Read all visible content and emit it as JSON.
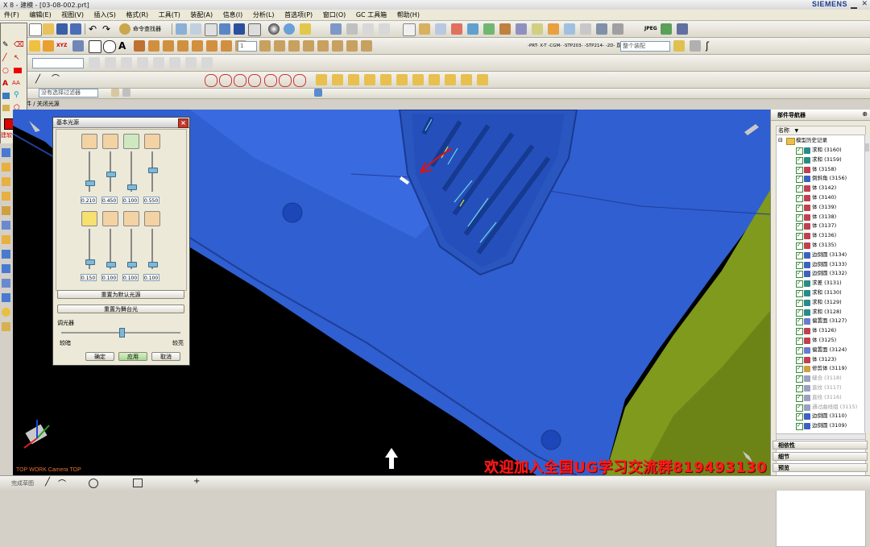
{
  "window": {
    "title": "X 8 - 建模 - [03-08-002.prt]",
    "brand": "SIEMENS"
  },
  "menu": [
    "件(F)",
    "编辑(E)",
    "视图(V)",
    "插入(S)",
    "格式(R)",
    "工具(T)",
    "装配(A)",
    "信息(I)",
    "分析(L)",
    "首选项(P)",
    "窗口(O)",
    "GC 工具箱",
    "帮助(H)"
  ],
  "toolbar": {
    "command_finder": "命令查找器",
    "jpeg": "JPEG",
    "export_text": "-PRT- X-T -CGM- -STP203- -STP214- -2D-  直线和圆弧(A)",
    "no_selection_filter": "没有选择过滤器",
    "layer_value": "1",
    "entire_assembly": "整个装配",
    "breadcrumb": "件 / 关闭光源"
  },
  "palette": {
    "label": "建软件"
  },
  "dialog": {
    "title": "基本光源",
    "row1_values": [
      "0.210",
      "0.450",
      "0.100",
      "0.550"
    ],
    "row1_levels": [
      0.21,
      0.45,
      0.1,
      0.55
    ],
    "row2_values": [
      "0.150",
      "0.100",
      "0.100",
      "0.100"
    ],
    "row2_levels": [
      0.15,
      0.1,
      0.1,
      0.1
    ],
    "reset_default": "重置为默认光源",
    "reset_stage": "重置为舞台光",
    "dimmer_label": "调光器",
    "dimmer_level": 0.5,
    "dark_label": "较暗",
    "bright_label": "较亮",
    "ok": "确定",
    "apply": "应用",
    "cancel": "取消"
  },
  "navigator": {
    "title": "部件导航器",
    "column_name": "名称",
    "root": "模型历史记录",
    "items": [
      {
        "label": "求和 (3160)",
        "icon": "unite-icon",
        "grey": false
      },
      {
        "label": "求和 (3159)",
        "icon": "unite-icon",
        "grey": false
      },
      {
        "label": "体 (3158)",
        "icon": "body-icon",
        "grey": false
      },
      {
        "label": "倒斜角 (3156)",
        "icon": "chamfer-icon",
        "grey": false
      },
      {
        "label": "体 (3142)",
        "icon": "body-icon",
        "grey": false
      },
      {
        "label": "体 (3140)",
        "icon": "body-icon",
        "grey": false
      },
      {
        "label": "体 (3139)",
        "icon": "body-icon",
        "grey": false
      },
      {
        "label": "体 (3138)",
        "icon": "body-icon",
        "grey": false
      },
      {
        "label": "体 (3137)",
        "icon": "body-icon",
        "grey": false
      },
      {
        "label": "体 (3136)",
        "icon": "body-icon",
        "grey": false
      },
      {
        "label": "体 (3135)",
        "icon": "body-icon",
        "grey": false
      },
      {
        "label": "边倒圆 (3134)",
        "icon": "edge-blend-icon",
        "grey": false
      },
      {
        "label": "边倒圆 (3133)",
        "icon": "edge-blend-icon",
        "grey": false
      },
      {
        "label": "边倒圆 (3132)",
        "icon": "edge-blend-icon",
        "grey": false
      },
      {
        "label": "求差 (3131)",
        "icon": "subtract-icon",
        "grey": false
      },
      {
        "label": "求和 (3130)",
        "icon": "unite-icon",
        "grey": false
      },
      {
        "label": "求和 (3129)",
        "icon": "unite-icon",
        "grey": false
      },
      {
        "label": "求和 (3128)",
        "icon": "unite-icon",
        "grey": false
      },
      {
        "label": "偏置面 (3127)",
        "icon": "offset-face-icon",
        "grey": false
      },
      {
        "label": "体 (3126)",
        "icon": "body-icon",
        "grey": false
      },
      {
        "label": "体 (3125)",
        "icon": "body-icon",
        "grey": false
      },
      {
        "label": "偏置面 (3124)",
        "icon": "offset-face-icon",
        "grey": false
      },
      {
        "label": "体 (3123)",
        "icon": "body-icon",
        "grey": false
      },
      {
        "label": "修剪体 (3119)",
        "icon": "trim-body-icon",
        "grey": false
      },
      {
        "label": "缝合 (3118)",
        "icon": "sew-icon",
        "grey": true
      },
      {
        "label": "直纹 (3117)",
        "icon": "ruled-icon",
        "grey": true
      },
      {
        "label": "直纹 (3116)",
        "icon": "ruled-icon",
        "grey": true
      },
      {
        "label": "通过曲线组 (3115)",
        "icon": "through-curves-icon",
        "grey": true
      },
      {
        "label": "边倒圆 (3110)",
        "icon": "edge-blend-icon",
        "grey": false
      },
      {
        "label": "边倒圆 (3109)",
        "icon": "edge-blend-icon",
        "grey": false
      }
    ],
    "sections": [
      "相依性",
      "细节",
      "预览"
    ]
  },
  "viewport": {
    "camera_label": "TOP WORK Camera TOP",
    "model_color": "#2f5fd0",
    "accent_color": "#7f9a1c"
  },
  "status": {
    "left_text": "完成草图"
  },
  "banner": "欢迎加入全国UG学习交流群819493130"
}
